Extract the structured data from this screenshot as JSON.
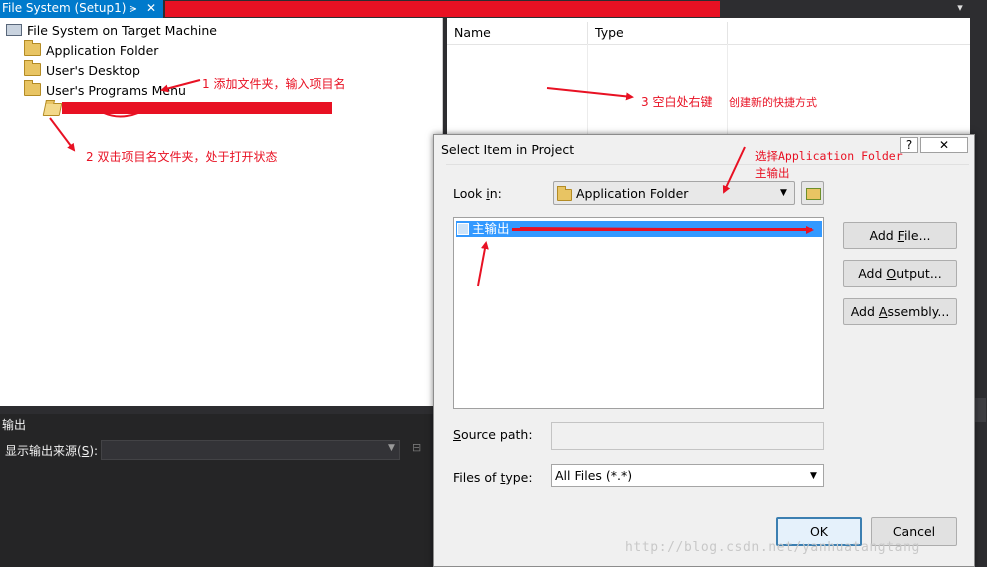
{
  "tab": {
    "title": "File System (Setup1)",
    "pin": "⪫",
    "close": "✕"
  },
  "tree": {
    "root": "File System on Target Machine",
    "items": [
      "Application Folder",
      "User's Desktop",
      "User's Programs Menu"
    ]
  },
  "list": {
    "columns": [
      "Name",
      "Type"
    ]
  },
  "output": {
    "title": "输出",
    "source_label_prefix": "显示输出来源(",
    "source_label_key": "S",
    "source_label_suffix": "):"
  },
  "dialog": {
    "title": "Select Item in Project",
    "help": "?",
    "close": "✕",
    "lookin_prefix": "Look ",
    "lookin_key": "i",
    "lookin_suffix": "n:",
    "lookin_value": "Application Folder",
    "item_label": "主输出",
    "add_file_prefix": "Add ",
    "add_file_key": "F",
    "add_file_suffix": "ile...",
    "add_output_prefix": "Add ",
    "add_output_key": "O",
    "add_output_suffix": "utput...",
    "add_assembly_prefix": "Add ",
    "add_assembly_key": "A",
    "add_assembly_suffix": "ssembly...",
    "source_prefix": "",
    "source_key": "S",
    "source_suffix": "ource path:",
    "filetype_prefix": "Files of ",
    "filetype_key": "t",
    "filetype_suffix": "ype:",
    "filetype_value": "All Files (*.*)",
    "ok": "OK",
    "cancel": "Cancel"
  },
  "annotations": {
    "a1": "1  添加文件夹，输入项目名",
    "a2": "2  双击项目名文件夹，处于打开状态",
    "a3": "3  空白处右键",
    "a3b": "创建新的快捷方式",
    "a4_line1": "选择Application Folder",
    "a4_line2": "主输出"
  },
  "watermark": "http://blog.csdn.net/yanhuatangtang",
  "colors": {
    "accent": "#007acc",
    "annotation": "#e81123",
    "selection": "#3399ff"
  }
}
